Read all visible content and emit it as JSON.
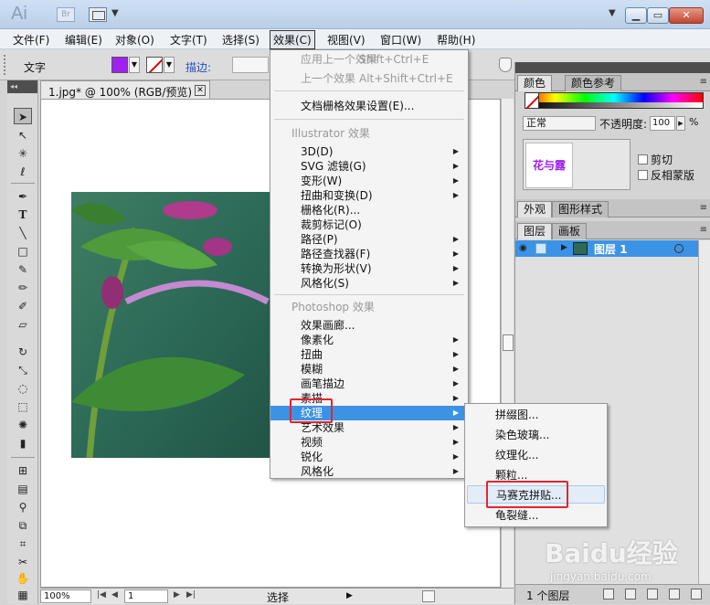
{
  "titlebar": {
    "logo": "Ai",
    "bridge_label": "Br",
    "icons": {
      "layout": "arrange-documents-icon",
      "minimize": "minimize-icon",
      "maximize": "restore-icon",
      "close": "close-icon"
    }
  },
  "menubar": {
    "items": [
      {
        "label": "文件(F)"
      },
      {
        "label": "编辑(E)"
      },
      {
        "label": "对象(O)"
      },
      {
        "label": "文字(T)"
      },
      {
        "label": "选择(S)"
      },
      {
        "label": "效果(C)"
      },
      {
        "label": "视图(V)"
      },
      {
        "label": "窗口(W)"
      },
      {
        "label": "帮助(H)"
      }
    ],
    "active_index": 5
  },
  "control_bar": {
    "label": "文字",
    "fill_color": "#a020f0",
    "stroke_label": "描边:"
  },
  "document": {
    "tab_label": "1.jpg* @ 100% (RGB/预览)",
    "close_glyph": "✕"
  },
  "status_bar": {
    "zoom": "100%",
    "page": "1",
    "label": "选择"
  },
  "effects_menu": {
    "items": [
      {
        "text": "应用上一个效果",
        "shortcut": "Shift+Ctrl+E",
        "disabled": true
      },
      {
        "text": "上一个效果",
        "shortcut": "Alt+Shift+Ctrl+E",
        "disabled": true
      },
      {
        "text": "文档栅格效果设置(E)..."
      },
      {
        "text": "Illustrator 效果",
        "section": true
      },
      {
        "text": "3D(D)",
        "submenu": true
      },
      {
        "text": "SVG 滤镜(G)",
        "submenu": true
      },
      {
        "text": "变形(W)",
        "submenu": true
      },
      {
        "text": "扭曲和变换(D)",
        "submenu": true
      },
      {
        "text": "栅格化(R)..."
      },
      {
        "text": "裁剪标记(O)"
      },
      {
        "text": "路径(P)",
        "submenu": true
      },
      {
        "text": "路径查找器(F)",
        "submenu": true
      },
      {
        "text": "转换为形状(V)",
        "submenu": true
      },
      {
        "text": "风格化(S)",
        "submenu": true
      },
      {
        "text": "Photoshop 效果",
        "section": true
      },
      {
        "text": "效果画廊..."
      },
      {
        "text": "像素化",
        "submenu": true
      },
      {
        "text": "扭曲",
        "submenu": true
      },
      {
        "text": "模糊",
        "submenu": true
      },
      {
        "text": "画笔描边",
        "submenu": true
      },
      {
        "text": "素描",
        "submenu": true
      },
      {
        "text": "纹理",
        "submenu": true,
        "highlighted": true
      },
      {
        "text": "艺术效果",
        "submenu": true
      },
      {
        "text": "视频",
        "submenu": true
      },
      {
        "text": "锐化",
        "submenu": true
      },
      {
        "text": "风格化",
        "submenu": true
      }
    ]
  },
  "texture_submenu": {
    "items": [
      {
        "text": "拼缀图..."
      },
      {
        "text": "染色玻璃..."
      },
      {
        "text": "纹理化..."
      },
      {
        "text": "颗粒..."
      },
      {
        "text": "马赛克拼贴...",
        "hover": true
      },
      {
        "text": "龟裂缝..."
      }
    ]
  },
  "color_panel": {
    "tabs": [
      "颜色",
      "颜色参考"
    ],
    "active_tab": 0
  },
  "transparency_panel": {
    "blend_mode": "正常",
    "opacity_label": "不透明度:",
    "opacity_value": "100",
    "opacity_unit": "%",
    "thumbnail_text": "花与露",
    "clip_label": "剪切",
    "invert_label": "反相蒙版"
  },
  "appearance_panel": {
    "tabs": [
      "外观",
      "图形样式"
    ]
  },
  "layers_panel": {
    "tabs": [
      "图层",
      "画板"
    ],
    "layer_name": "图层 1",
    "count_label": "1 个图层"
  },
  "watermark": {
    "brand": "Baidu经验",
    "url": "jingyan.baidu.com"
  },
  "colors": {
    "menu_highlight": "#3c93e6",
    "annotation_red": "#e8242c",
    "fill_purple": "#a020f0"
  }
}
